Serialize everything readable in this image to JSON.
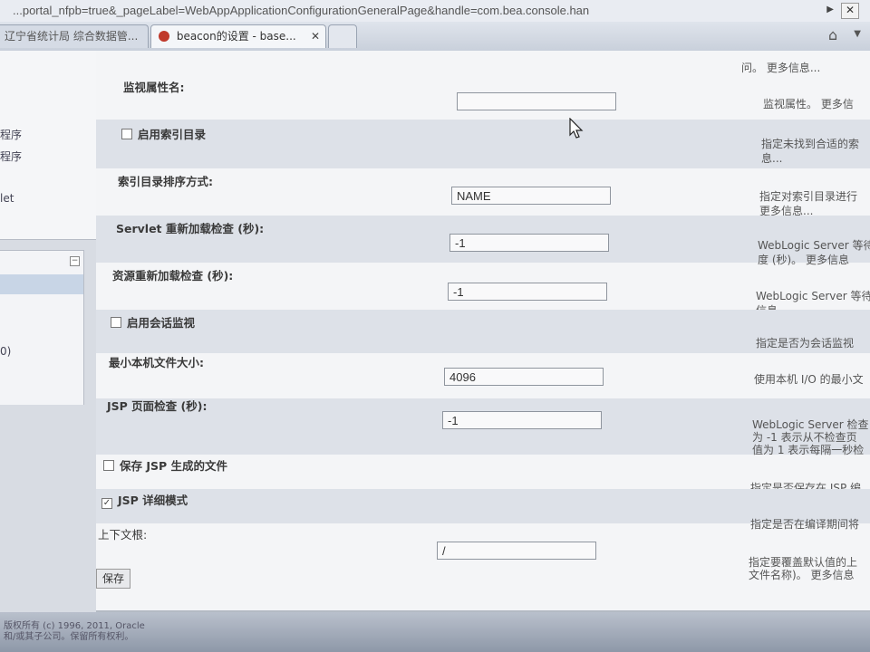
{
  "browser": {
    "url": "...portal_nfpb=true&_pageLabel=WebAppApplicationConfigurationGeneralPage&handle=com.bea.console.han",
    "close_label": "✕",
    "tabs": [
      {
        "label": "辽宁省统计局 综合数据管..."
      },
      {
        "label": "beacon的设置 - base...",
        "close": "✕"
      }
    ],
    "home_icon": "home-icon"
  },
  "sidebar": {
    "top_items": [
      "程序",
      "程序",
      "let"
    ],
    "bottom_items": [
      "0)"
    ],
    "collapse": "−"
  },
  "form": {
    "fields": [
      {
        "label": "监视属性名:",
        "value": "",
        "desc": [
          "监视属性。 更多信"
        ]
      },
      {
        "label": "启用索引目录",
        "checkbox": true,
        "checked": false,
        "desc": [
          "指定未找到合适的索",
          "息..."
        ]
      },
      {
        "label": "索引目录排序方式:",
        "value": "NAME",
        "desc": [
          "指定对索引目录进行",
          "更多信息..."
        ]
      },
      {
        "label": "Servlet 重新加载检查 (秒):",
        "value": "-1",
        "desc": [
          "WebLogic Server 等待",
          "度 (秒)。 更多信息"
        ]
      },
      {
        "label": "资源重新加载检查 (秒):",
        "value": "-1",
        "desc": [
          "WebLogic Server 等待",
          "信息..."
        ]
      },
      {
        "label": "启用会话监视",
        "checkbox": true,
        "checked": false,
        "desc": [
          "指定是否为会话监视"
        ]
      },
      {
        "label": "最小本机文件大小:",
        "value": "4096",
        "desc": [
          "使用本机 I/O 的最小文"
        ]
      },
      {
        "label": "JSP 页面检查 (秒):",
        "value": "-1",
        "desc": [
          "WebLogic Server 检查",
          "为 -1 表示从不检查页",
          "值为 1 表示每隔一秒检"
        ]
      },
      {
        "label": "保存 JSP 生成的文件",
        "checkbox": true,
        "checked": false,
        "desc": [
          "指定是否保存在 JSP 编"
        ]
      },
      {
        "label": "JSP 详细模式",
        "checkbox": true,
        "checked": true,
        "desc": [
          "指定是否在编译期间将"
        ]
      },
      {
        "label": "上下文根:",
        "value": "/",
        "desc": [
          "指定要覆盖默认值的上",
          "文件名称)。 更多信息"
        ]
      }
    ],
    "top_desc": "问。 更多信息...",
    "save_label": "保存"
  },
  "taskbar": {
    "text": [
      "版权所有 (c) 1996, 2011, Oracle",
      "和/或其子公司。保留所有权利。"
    ]
  },
  "colors": {
    "shaded_row": "#dde1e8",
    "panel": "#f4f5f7"
  }
}
